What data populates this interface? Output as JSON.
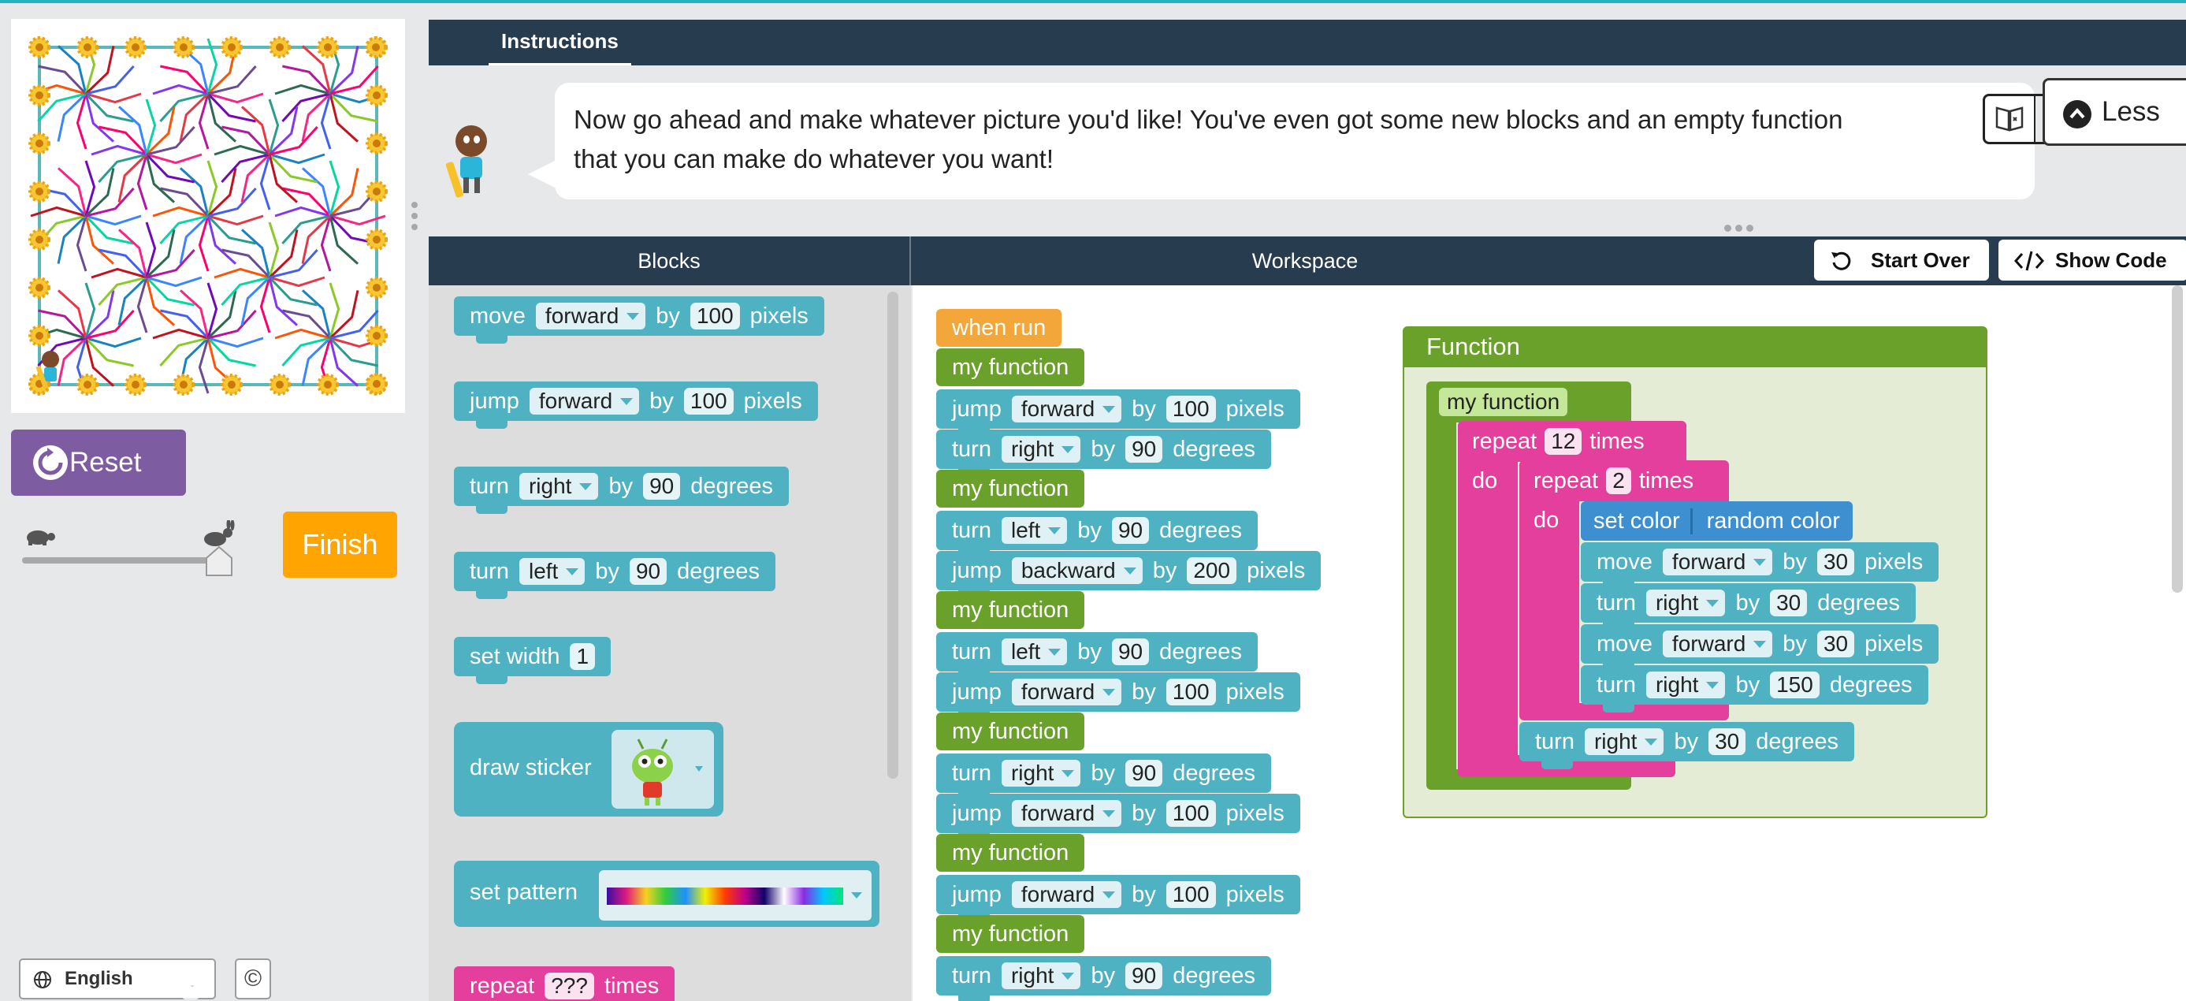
{
  "left_panel": {
    "reset_label": "Reset",
    "finish_label": "Finish",
    "language": "English",
    "copyright_symbol": "©",
    "speed_level": 1.0
  },
  "instructions": {
    "tab_label": "Instructions",
    "text": "Now go ahead and make whatever picture you'd like! You've even got some new blocks and an empty function that you can make do whatever you want!",
    "less_label": "Less"
  },
  "header": {
    "blocks_label": "Blocks",
    "workspace_label": "Workspace",
    "start_over_label": "Start Over",
    "show_code_label": "Show Code"
  },
  "toolbox": {
    "move": {
      "verb": "move",
      "dir": "forward",
      "by": "by",
      "value": "100",
      "unit": "pixels"
    },
    "jump": {
      "verb": "jump",
      "dir": "forward",
      "by": "by",
      "value": "100",
      "unit": "pixels"
    },
    "turn_right": {
      "verb": "turn",
      "dir": "right",
      "by": "by",
      "value": "90",
      "unit": "degrees"
    },
    "turn_left": {
      "verb": "turn",
      "dir": "left",
      "by": "by",
      "value": "90",
      "unit": "degrees"
    },
    "set_width": {
      "label": "set width",
      "value": "1"
    },
    "draw_sticker": {
      "label": "draw sticker"
    },
    "set_pattern": {
      "label": "set pattern"
    },
    "repeat": {
      "label": "repeat",
      "value": "???",
      "unit": "times"
    }
  },
  "workspace": {
    "when_run": "when run",
    "fn_name": "my function",
    "by": "by",
    "program": [
      {
        "verb": "jump",
        "dir": "forward",
        "value": "100",
        "unit": "pixels"
      },
      {
        "verb": "turn",
        "dir": "right",
        "value": "90",
        "unit": "degrees"
      },
      {
        "verb": "turn",
        "dir": "left",
        "value": "90",
        "unit": "degrees"
      },
      {
        "verb": "jump",
        "dir": "backward",
        "value": "200",
        "unit": "pixels"
      },
      {
        "verb": "turn",
        "dir": "left",
        "value": "90",
        "unit": "degrees"
      },
      {
        "verb": "jump",
        "dir": "forward",
        "value": "100",
        "unit": "pixels"
      },
      {
        "verb": "turn",
        "dir": "right",
        "value": "90",
        "unit": "degrees"
      },
      {
        "verb": "jump",
        "dir": "forward",
        "value": "100",
        "unit": "pixels"
      },
      {
        "verb": "jump",
        "dir": "forward",
        "value": "100",
        "unit": "pixels"
      },
      {
        "verb": "turn",
        "dir": "right",
        "value": "90",
        "unit": "degrees"
      }
    ],
    "function": {
      "title": "Function",
      "name": "my function",
      "repeat_label": "repeat",
      "times_label": "times",
      "do_label": "do",
      "outer_times": "12",
      "inner_times": "2",
      "set_color": "set color",
      "random_color": "random color",
      "inner": [
        {
          "verb": "move",
          "dir": "forward",
          "value": "30",
          "unit": "pixels"
        },
        {
          "verb": "turn",
          "dir": "right",
          "value": "30",
          "unit": "degrees"
        },
        {
          "verb": "move",
          "dir": "forward",
          "value": "30",
          "unit": "pixels"
        },
        {
          "verb": "turn",
          "dir": "right",
          "value": "150",
          "unit": "degrees"
        }
      ],
      "after": {
        "verb": "turn",
        "dir": "right",
        "value": "30",
        "unit": "degrees"
      }
    }
  },
  "colors": {
    "motion_teal": "#4fb2c3",
    "function_green": "#6aa12b",
    "event_orange": "#f3a73b",
    "loop_pink": "#e43f9d",
    "color_blue": "#3d8fd0",
    "reset_purple": "#7e5ca2",
    "finish_orange": "#ffa400",
    "header_navy": "#283c4f"
  }
}
